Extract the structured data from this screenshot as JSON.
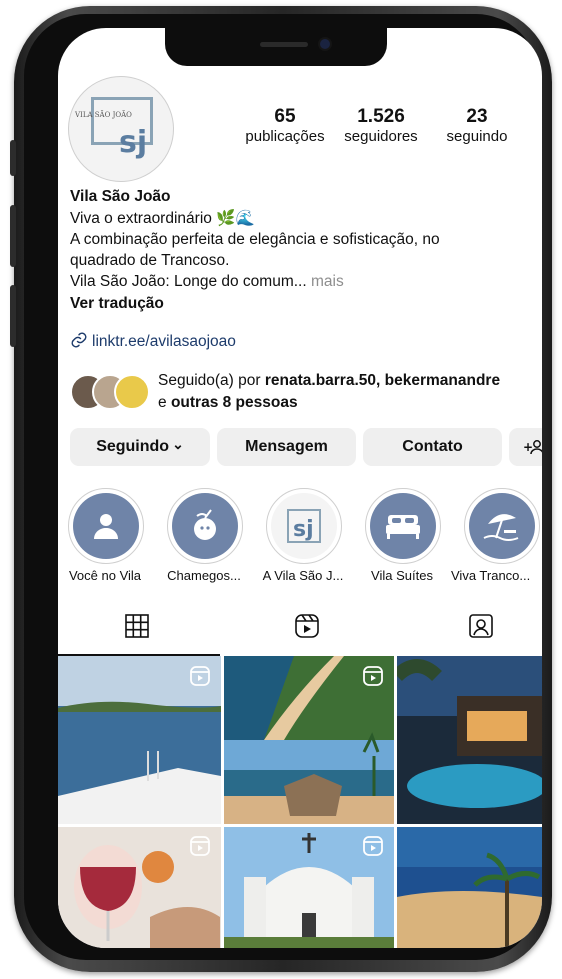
{
  "profile": {
    "logo_text": "VILA SÃO JOÃO",
    "logo_mark": "sj",
    "stats": [
      {
        "value": "65",
        "label": "publicações"
      },
      {
        "value": "1.526",
        "label": "seguidores"
      },
      {
        "value": "23",
        "label": "seguindo"
      }
    ],
    "name": "Vila São João",
    "bio_line1": "Viva o extraordinário",
    "bio_emojis": "🌿🌊",
    "bio_line2": "A combinação perfeita de elegância e sofisticação, no",
    "bio_line3": "quadrado de Trancoso.",
    "bio_line4": "Vila São João: Longe do comum...",
    "more": "mais",
    "translate": "Ver tradução",
    "link": "linktr.ee/avilasaojoao",
    "followed_prefix": "Seguido(a) por",
    "followed_users": "renata.barra.50, bekermanandre",
    "followed_and": "e",
    "followed_others": "outras 8 pessoas"
  },
  "buttons": {
    "following": "Seguindo",
    "chevron": "⌄",
    "message": "Mensagem",
    "contact": "Contato",
    "add_person": "+👤"
  },
  "highlights": [
    {
      "label": "Você no Vila",
      "icon": "person-icon"
    },
    {
      "label": "Chamegos...",
      "icon": "coconut-drink-icon"
    },
    {
      "label": "A Vila São J...",
      "icon": "sj-logo-icon"
    },
    {
      "label": "Vila Suítes",
      "icon": "bed-icon"
    },
    {
      "label": "Viva Tranco...",
      "icon": "beach-umbrella-icon"
    }
  ],
  "tabs": [
    {
      "name": "grid-icon"
    },
    {
      "name": "reels-icon"
    },
    {
      "name": "tagged-icon"
    }
  ],
  "grid": [
    {
      "name": "post-boat-sea",
      "colors": [
        "#b9cde0",
        "#3d6f9b"
      ],
      "reel": true
    },
    {
      "name": "post-aerial-coast",
      "colors": [
        "#4a7d3c",
        "#1f5d80"
      ],
      "reel": true
    },
    {
      "name": "post-pool-night",
      "colors": [
        "#1d2c3c",
        "#2a8db1"
      ],
      "reel": false
    },
    {
      "name": "post-wine-glass",
      "colors": [
        "#e8e0d8",
        "#a32a3a"
      ],
      "reel": true
    },
    {
      "name": "post-white-church",
      "colors": [
        "#8fbde5",
        "#f2f2f0"
      ],
      "reel": true
    },
    {
      "name": "post-beach-palm",
      "colors": [
        "#1c4e88",
        "#d8b27a"
      ],
      "reel": false
    }
  ]
}
